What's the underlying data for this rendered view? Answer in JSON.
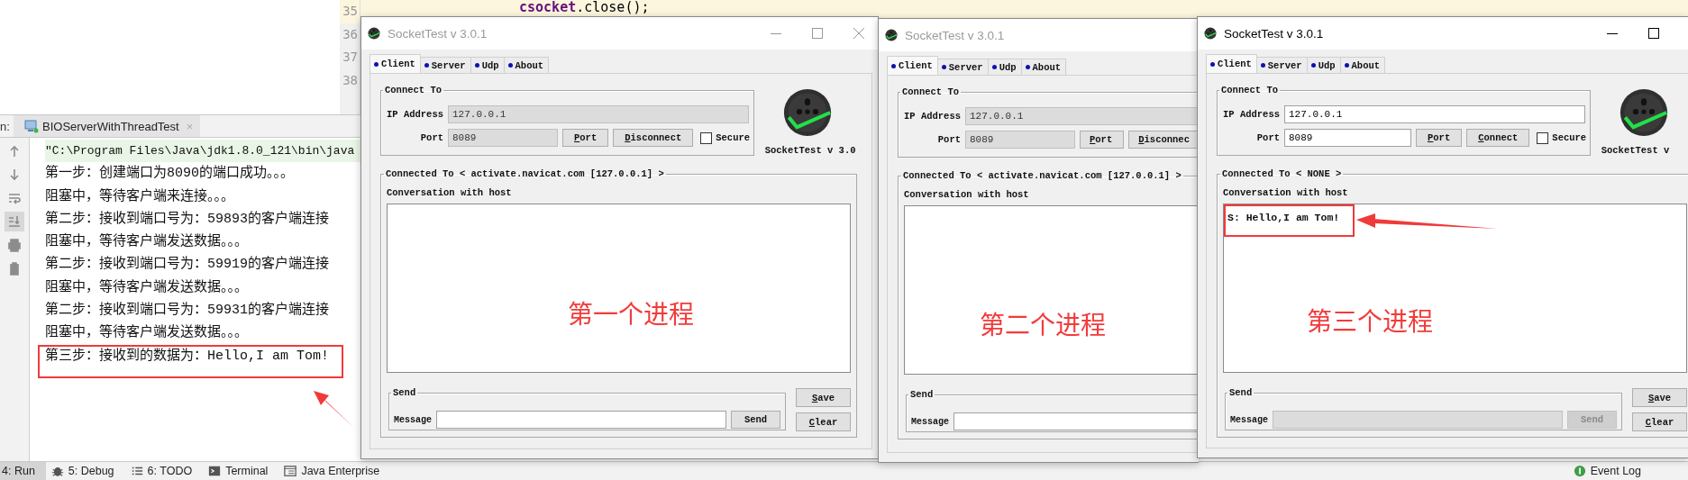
{
  "editor": {
    "lines": [
      {
        "number": "35",
        "code": "**csocket**.close();",
        "current": true
      },
      {
        "number": "36",
        "current": false
      },
      {
        "number": "37",
        "current": false
      },
      {
        "number": "38",
        "current": false
      }
    ]
  },
  "run_panel": {
    "label": "n:",
    "tab": {
      "title": "BIOServerWithThreadTest",
      "close": "×"
    },
    "toolbar": [
      {
        "kind": "up",
        "selected": false
      },
      {
        "kind": "down",
        "selected": false
      },
      {
        "kind": "wrap",
        "selected": false
      },
      {
        "kind": "scroll-end",
        "selected": true
      },
      {
        "kind": "print",
        "selected": false
      },
      {
        "kind": "trash",
        "selected": false
      }
    ],
    "console": [
      {
        "kind": "command",
        "text": "\"C:\\Program Files\\Java\\jdk1.8.0_121\\bin\\java",
        "highlighted": false
      },
      {
        "kind": "output",
        "text": "第一步：创建端口为8090的端口成功。。。",
        "highlighted": false
      },
      {
        "kind": "output",
        "text": "阻塞中，等待客户端来连接。。。",
        "highlighted": false
      },
      {
        "kind": "output",
        "text": "第二步：接收到端口号为：59893的客户端连接",
        "highlighted": false
      },
      {
        "kind": "output",
        "text": "阻塞中，等待客户端发送数据。。。",
        "highlighted": false
      },
      {
        "kind": "output",
        "text": "第二步：接收到端口号为：59919的客户端连接",
        "highlighted": false
      },
      {
        "kind": "output",
        "text": "阻塞中，等待客户端发送数据。。。",
        "highlighted": false
      },
      {
        "kind": "output",
        "text": "第二步：接收到端口号为：59931的客户端连接",
        "highlighted": false
      },
      {
        "kind": "output",
        "text": "阻塞中，等待客户端发送数据。。。",
        "highlighted": false
      },
      {
        "kind": "output",
        "text": "第三步：接收到的数据为：Hello,I am Tom!",
        "highlighted": true
      }
    ]
  },
  "windows": [
    {
      "title": "SocketTest v 3.0.1",
      "active": false,
      "controls": [
        {
          "kind": "minimize"
        },
        {
          "kind": "maximize"
        },
        {
          "kind": "close"
        }
      ],
      "tabs": [
        {
          "label": "Client",
          "selected": true
        },
        {
          "label": "Server",
          "selected": false
        },
        {
          "label": "Udp",
          "selected": false
        },
        {
          "label": "About",
          "selected": false
        }
      ],
      "connect_legend": "Connect To",
      "ip_label": "IP Address",
      "ip_value": "127.0.0.1",
      "port_label": "Port",
      "port_value": "8089",
      "fields_disabled": true,
      "buttons": [
        {
          "label": "Port",
          "mnemonic": true
        },
        {
          "label": "Disconnect",
          "mnemonic": true
        }
      ],
      "secure": {
        "label": "Secure",
        "checked": false
      },
      "logo_label": "SocketTest v 3.0",
      "connected_legend": "Connected To <  activate.navicat.com [127.0.0.1]  >",
      "conversation_label": "Conversation with host",
      "annotation": "第一个进程",
      "send_legend": "Send",
      "message_label": "Message",
      "message_disabled": false,
      "send_button": {
        "label": "Send",
        "disabled": false
      },
      "side_buttons": [
        {
          "label": "Save",
          "mnemonic": true
        },
        {
          "label": "Clear",
          "mnemonic": true
        }
      ]
    },
    {
      "title": "SocketTest v 3.0.1",
      "active": false,
      "tabs": [
        {
          "label": "Client",
          "selected": true
        },
        {
          "label": "Server",
          "selected": false
        },
        {
          "label": "Udp",
          "selected": false
        },
        {
          "label": "About",
          "selected": false
        }
      ],
      "connect_legend": "Connect To",
      "ip_label": "IP Address",
      "ip_value": "127.0.0.1",
      "port_label": "Port",
      "port_value": "8089",
      "fields_disabled": true,
      "buttons": [
        {
          "label": "Port",
          "mnemonic": true
        },
        {
          "label": "Disconnec",
          "mnemonic": true
        }
      ],
      "connected_legend": "Connected To <  activate.navicat.com [127.0.0.1]  >",
      "conversation_label": "Conversation with host",
      "annotation": "第二个进程",
      "send_legend": "Send",
      "message_label": "Message",
      "message_disabled": false
    },
    {
      "title": "SocketTest v 3.0.1",
      "active": true,
      "controls": [
        {
          "kind": "minimize"
        },
        {
          "kind": "maximize"
        }
      ],
      "tabs": [
        {
          "label": "Client",
          "selected": true
        },
        {
          "label": "Server",
          "selected": false
        },
        {
          "label": "Udp",
          "selected": false
        },
        {
          "label": "About",
          "selected": false
        }
      ],
      "connect_legend": "Connect To",
      "ip_label": "IP Address",
      "ip_value": "127.0.0.1",
      "port_label": "Port",
      "port_value": "8089",
      "fields_disabled": false,
      "buttons": [
        {
          "label": "Port",
          "mnemonic": true
        },
        {
          "label": "Connect",
          "mnemonic": true
        }
      ],
      "secure": {
        "label": "Secure",
        "checked": false
      },
      "logo_label": "SocketTest v",
      "connected_legend": "Connected To < NONE >",
      "conversation_label": "Conversation with host",
      "messages": [
        {
          "text": "S: Hello,I am Tom!",
          "highlighted": true
        }
      ],
      "annotation": "第三个进程",
      "send_legend": "Send",
      "message_label": "Message",
      "message_disabled": true,
      "send_button": {
        "label": "Send",
        "disabled": true
      },
      "side_buttons": [
        {
          "label": "Save",
          "mnemonic": true
        },
        {
          "label": "Clear",
          "mnemonic": true
        }
      ]
    }
  ],
  "bottom_bar": {
    "tools": [
      {
        "label": "4: Run",
        "kind": "run",
        "selected": true
      },
      {
        "label": "5: Debug",
        "kind": "debug",
        "selected": false
      },
      {
        "label": "6: TODO",
        "kind": "todo",
        "selected": false
      },
      {
        "label": "Terminal",
        "kind": "terminal",
        "selected": false
      },
      {
        "label": "Java Enterprise",
        "kind": "enterprise",
        "selected": false
      }
    ],
    "event_log": "Event Log"
  }
}
